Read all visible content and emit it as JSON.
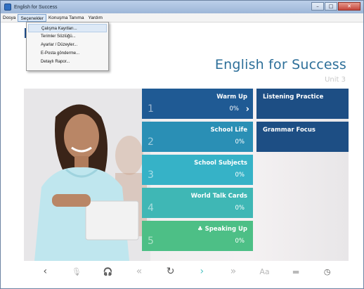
{
  "window": {
    "title": "English for Success"
  },
  "menubar": {
    "items": [
      "Dosya",
      "Seçenekler",
      "Konuşma Tanıma",
      "Yardım"
    ]
  },
  "dropdown": {
    "items": [
      "Çalışma Kayıtları...",
      "Terimler Sözlüğü...",
      "Ayarlar / Düzeyler...",
      "E-Posta gönderme...",
      "Detaylı Rapor..."
    ]
  },
  "header": {
    "title": "English for Success",
    "unit": "Unit 3"
  },
  "lessons": [
    {
      "num": "1",
      "title": "Warm Up",
      "progress": "0%",
      "color": "#1f5a94"
    },
    {
      "num": "2",
      "title": "School Life",
      "progress": "0%",
      "color": "#2a8fb5"
    },
    {
      "num": "3",
      "title": "School Subjects",
      "progress": "0%",
      "color": "#36b2c7"
    },
    {
      "num": "4",
      "title": "World Talk Cards",
      "progress": "0%",
      "color": "#3fb7b5"
    },
    {
      "num": "5",
      "title": "Speaking Up",
      "progress": "0%",
      "color": "#4dbf86"
    }
  ],
  "side_tiles": [
    "Listening Practice",
    "Grammar Focus"
  ],
  "toolbar": {
    "back": "‹",
    "mic": "🎙",
    "headset": "🎧",
    "rewind": "«",
    "refresh": "↻",
    "next": "›",
    "forward": "»",
    "font": "Aa",
    "keyboard": "▬",
    "timer": "◷"
  },
  "colors": {
    "title_blue": "#2d6f99",
    "tile_dark": "#1d4e84"
  }
}
